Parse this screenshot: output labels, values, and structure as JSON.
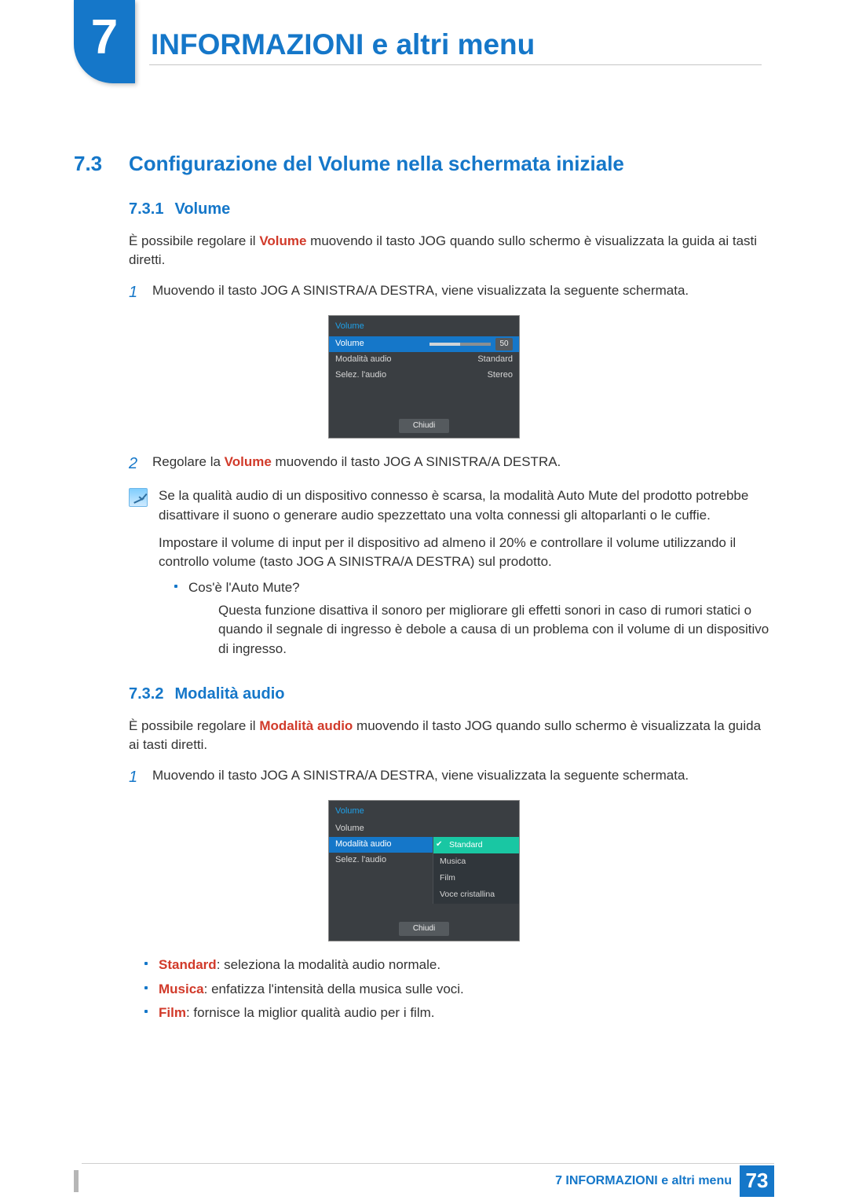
{
  "chapter": {
    "number": "7",
    "title": "INFORMAZIONI e altri menu"
  },
  "section": {
    "number": "7.3",
    "title": "Configurazione del Volume nella schermata iniziale"
  },
  "sub1": {
    "number": "7.3.1",
    "title": "Volume",
    "intro_pre": "È possibile regolare il ",
    "intro_kw": "Volume",
    "intro_post": " muovendo il tasto JOG quando sullo schermo è visualizzata la guida ai tasti diretti.",
    "step1_num": "1",
    "step1": "Muovendo il tasto JOG A SINISTRA/A DESTRA, viene visualizzata la seguente schermata.",
    "step2_num": "2",
    "step2_pre": "Regolare la ",
    "step2_kw": "Volume",
    "step2_post": " muovendo il tasto JOG A SINISTRA/A DESTRA.",
    "note_p1": "Se la qualità audio di un dispositivo connesso è scarsa, la modalità Auto Mute del prodotto potrebbe disattivare il suono o generare audio spezzettato una volta connessi gli altoparlanti o le cuffie.",
    "note_p2": "Impostare il volume di input per il dispositivo ad almeno il 20% e controllare il volume utilizzando il controllo volume (tasto JOG A SINISTRA/A DESTRA) sul prodotto.",
    "note_q": "Cos'è l'Auto Mute?",
    "note_a": "Questa funzione disattiva il sonoro per migliorare gli effetti sonori in caso di rumori statici o quando il segnale di ingresso è debole a causa di un problema con il volume di un dispositivo di ingresso."
  },
  "sub2": {
    "number": "7.3.2",
    "title": "Modalità audio",
    "intro_pre": "È possibile regolare il ",
    "intro_kw": "Modalità audio",
    "intro_post": " muovendo il tasto JOG quando sullo schermo è visualizzata la guida ai tasti diretti.",
    "step1_num": "1",
    "step1": "Muovendo il tasto JOG A SINISTRA/A DESTRA, viene visualizzata la seguente schermata.",
    "b1_kw": "Standard",
    "b1_txt": ": seleziona la modalità audio normale.",
    "b2_kw": "Musica",
    "b2_txt": ": enfatizza l'intensità della musica sulle voci.",
    "b3_kw": "Film",
    "b3_txt": ": fornisce la miglior qualità audio per i film."
  },
  "osd1": {
    "title": "Volume",
    "rows": {
      "volume_label": "Volume",
      "volume_value": "50",
      "mode_label": "Modalità audio",
      "mode_value": "Standard",
      "select_label": "Selez. l'audio",
      "select_value": "Stereo"
    },
    "close": "Chiudi"
  },
  "osd2": {
    "title": "Volume",
    "rows": {
      "volume_label": "Volume",
      "mode_label": "Modalità audio",
      "select_label": "Selez. l'audio"
    },
    "options": {
      "o1": "Standard",
      "o2": "Musica",
      "o3": "Film",
      "o4": "Voce cristallina"
    },
    "close": "Chiudi"
  },
  "footer": {
    "chapter_label": "7 INFORMAZIONI e altri menu",
    "page": "73"
  }
}
